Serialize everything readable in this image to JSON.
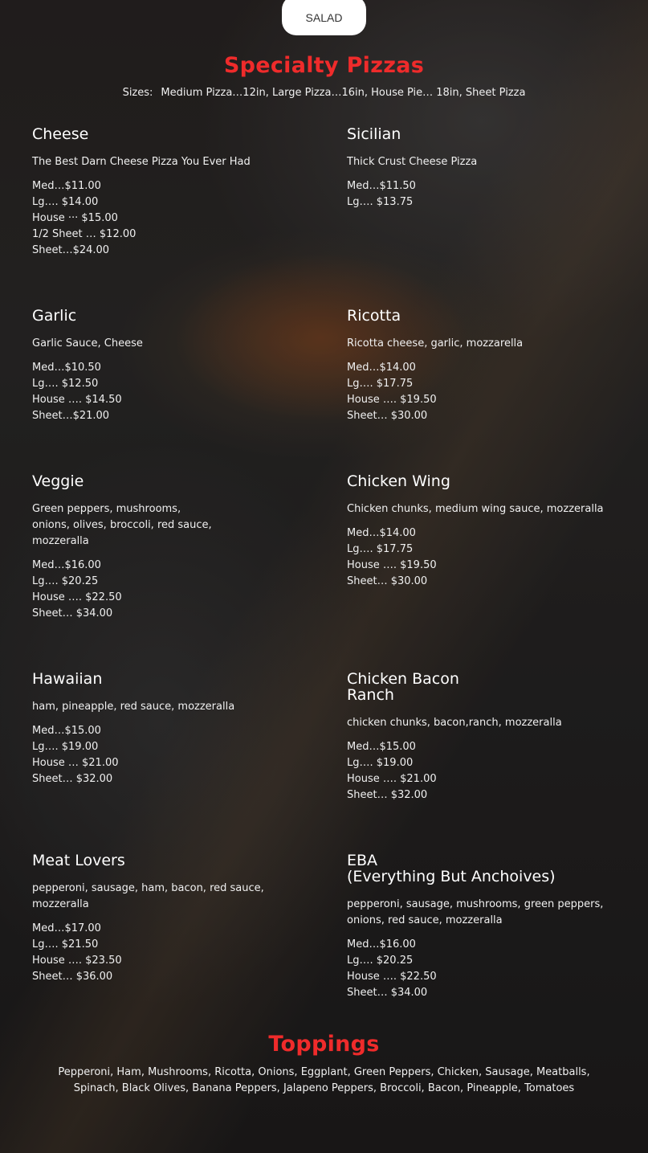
{
  "nav": {
    "salad_label": "SALAD"
  },
  "specialty": {
    "title": "Specialty Pizzas",
    "sizes_label": "Sizes:",
    "sizes_text": "Medium Pizza…12in, Large Pizza…16in, House Pie… 18in, Sheet Pizza"
  },
  "items": [
    {
      "name": "Cheese",
      "desc": "The Best Darn Cheese Pizza You Ever Had",
      "prices": [
        "Med…$11.00",
        "Lg…. $14.00",
        "House ··· $15.00",
        "1/2 Sheet … $12.00",
        "Sheet…$24.00"
      ]
    },
    {
      "name": "Sicilian",
      "desc": "Thick Crust Cheese Pizza",
      "prices": [
        "Med…$11.50",
        "Lg…. $13.75"
      ]
    },
    {
      "name": "Garlic",
      "desc": "Garlic Sauce, Cheese",
      "prices": [
        "Med…$10.50",
        "Lg…. $12.50",
        "House …. $14.50",
        "Sheet…$21.00"
      ]
    },
    {
      "name": "Ricotta",
      "desc": "Ricotta cheese, garlic, mozzarella",
      "prices": [
        "Med…$14.00",
        "Lg…. $17.75",
        "House …. $19.50",
        "Sheet… $30.00"
      ]
    },
    {
      "name": "Veggie",
      "desc": "Green peppers, mushrooms,\nonions, olives, broccoli, red sauce,\nmozzeralla",
      "prices": [
        "Med…$16.00",
        "Lg…. $20.25",
        "House …. $22.50",
        "Sheet… $34.00"
      ]
    },
    {
      "name": "Chicken Wing",
      "desc": "Chicken chunks, medium wing sauce, mozzeralla",
      "prices": [
        "Med…$14.00",
        "Lg…. $17.75",
        "House …. $19.50",
        "Sheet… $30.00"
      ]
    },
    {
      "name": "Hawaiian",
      "desc": "ham, pineapple, red sauce, mozzeralla",
      "prices": [
        "Med…$15.00",
        "Lg…. $19.00",
        "House … $21.00",
        "Sheet… $32.00"
      ]
    },
    {
      "name": "Chicken Bacon\nRanch",
      "desc": "chicken chunks, bacon,ranch, mozzeralla",
      "prices": [
        "Med…$15.00",
        "Lg…. $19.00",
        "House …. $21.00",
        "Sheet… $32.00"
      ]
    },
    {
      "name": "Meat Lovers",
      "desc": "pepperoni, sausage, ham, bacon, red sauce,\nmozzeralla",
      "prices": [
        "Med…$17.00",
        "Lg…. $21.50",
        "House …. $23.50",
        "Sheet… $36.00"
      ]
    },
    {
      "name": "EBA\n(Everything But Anchoives)",
      "desc": "pepperoni, sausage, mushrooms, green peppers,\nonions, red sauce, mozzeralla",
      "prices": [
        "Med…$16.00",
        "Lg…. $20.25",
        "House …. $22.50",
        "Sheet… $34.00"
      ]
    }
  ],
  "toppings": {
    "title": "Toppings",
    "list": "Pepperoni, Ham, Mushrooms, Ricotta, Onions, Eggplant, Green Peppers, Chicken, Sausage, Meatballs,\nSpinach, Black Olives, Banana Peppers, Jalapeno Peppers, Broccoli, Bacon, Pineapple, Tomatoes"
  }
}
